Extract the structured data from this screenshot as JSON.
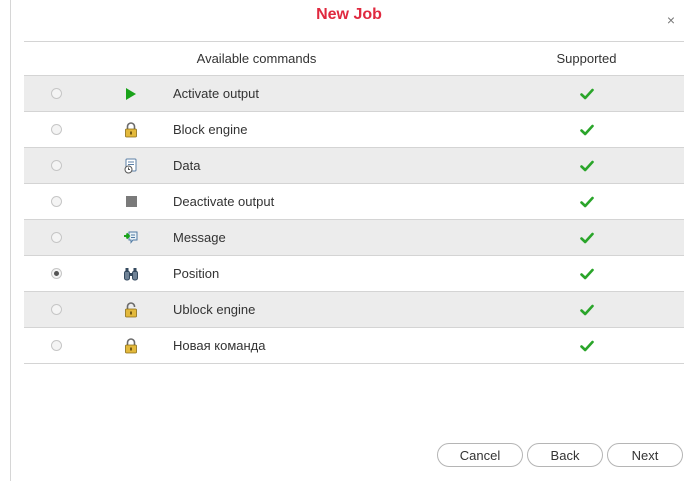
{
  "dialog": {
    "title": "New Job",
    "close_label": "×"
  },
  "table": {
    "header_commands": "Available commands",
    "header_supported": "Supported",
    "rows": [
      {
        "name": "Activate output",
        "icon": "play-icon",
        "selected": false,
        "supported": true
      },
      {
        "name": "Block engine",
        "icon": "lock-icon",
        "selected": false,
        "supported": true
      },
      {
        "name": "Data",
        "icon": "data-request-icon",
        "selected": false,
        "supported": true
      },
      {
        "name": "Deactivate output",
        "icon": "stop-icon",
        "selected": false,
        "supported": true
      },
      {
        "name": "Message",
        "icon": "message-icon",
        "selected": false,
        "supported": true
      },
      {
        "name": "Position",
        "icon": "binoculars-icon",
        "selected": true,
        "supported": true
      },
      {
        "name": "Ublock engine",
        "icon": "unlock-icon",
        "selected": false,
        "supported": true
      },
      {
        "name": "Новая команда",
        "icon": "lock-icon",
        "selected": false,
        "supported": true
      }
    ]
  },
  "buttons": {
    "cancel": "Cancel",
    "back": "Back",
    "next": "Next"
  },
  "colors": {
    "title": "#e0293f",
    "check": "#2aa52a",
    "play": "#1aa31a"
  }
}
